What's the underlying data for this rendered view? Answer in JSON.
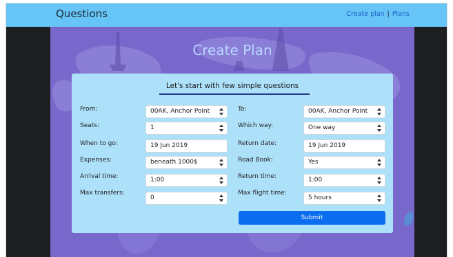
{
  "nav": {
    "brand": "Questions",
    "links": [
      "Create plan",
      "Plans"
    ],
    "separator": "|"
  },
  "hero": {
    "title": "Create Plan"
  },
  "form": {
    "heading": "Let's start with few simple questions",
    "from": {
      "label": "From:",
      "value": "00AK, Anchor Point"
    },
    "to": {
      "label": "To:",
      "value": "00AK, Anchor Point"
    },
    "seats": {
      "label": "Seats:",
      "value": "1"
    },
    "which_way": {
      "label": "Which way:",
      "value": "One way"
    },
    "when_to_go": {
      "label": "When to go:",
      "value": "19 Jun 2019"
    },
    "return_date": {
      "label": "Return date:",
      "value": "19 Jun 2019"
    },
    "expenses": {
      "label": "Expenses:",
      "value": "beneath 1000$"
    },
    "road_book": {
      "label": "Road Book:",
      "value": "Yes"
    },
    "arrival_time": {
      "label": "Arrival time:",
      "value": "1:00"
    },
    "return_time": {
      "label": "Return time:",
      "value": "1:00"
    },
    "max_transfers": {
      "label": "Max transfers:",
      "value": "0"
    },
    "max_flight_time": {
      "label": "Max flight time:",
      "value": "5 hours"
    },
    "submit_label": "Submit"
  },
  "colors": {
    "navbar": "#66c4f6",
    "hero": "#7868cb",
    "card": "#ade0f9",
    "submit": "#0b6df0",
    "title": "#b7d8ff"
  }
}
